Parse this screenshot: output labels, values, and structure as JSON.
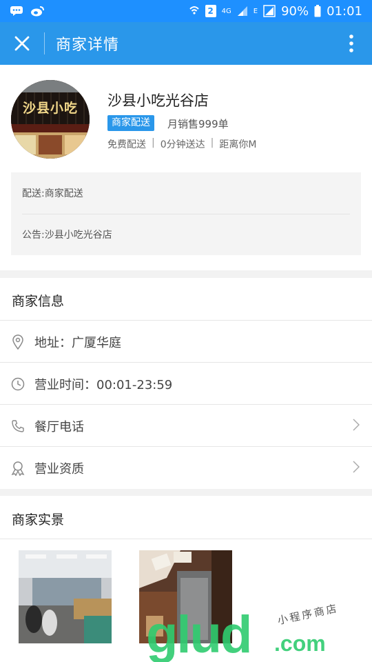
{
  "status_bar": {
    "sim": "2",
    "network": "4G",
    "signal_type": "E",
    "battery": "90%",
    "time": "01:01"
  },
  "app_bar": {
    "title": "商家详情"
  },
  "shop": {
    "name": "沙县小吃光谷店",
    "delivery_tag": "商家配送",
    "monthly_sales": "月销售999单",
    "meta": {
      "free_delivery": "免费配送",
      "delivery_time": "0分钟送达",
      "distance": "距离你M"
    },
    "sign_text": "沙县小吃"
  },
  "notice": {
    "delivery": "配送:商家配送",
    "announcement": "公告:沙县小吃光谷店"
  },
  "merchant_info": {
    "title": "商家信息",
    "rows": [
      {
        "label": "地址：广厦华庭",
        "icon": "location-icon"
      },
      {
        "label": "营业时间：00:01-23:59",
        "icon": "clock-icon"
      },
      {
        "label": "餐厅电话",
        "icon": "phone-icon"
      },
      {
        "label": "营业资质",
        "icon": "award-icon"
      }
    ]
  },
  "photos": {
    "title": "商家实景"
  },
  "watermark": {
    "main": "glud",
    "suffix": ".com",
    "tagline": "小程序商店"
  },
  "colors": {
    "primary": "#2a97ea",
    "status_bar": "#1e90ff",
    "tag_blue": "#2a97ea",
    "watermark_green": "#2fcc6f"
  }
}
